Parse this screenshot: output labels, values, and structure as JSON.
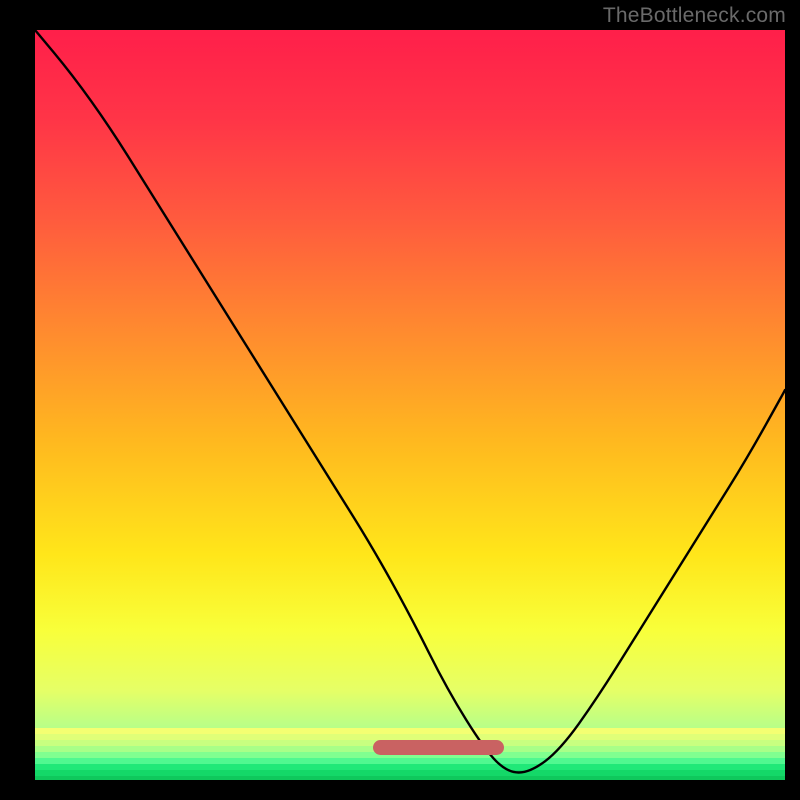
{
  "watermark": {
    "text": "TheBottleneck.com"
  },
  "gradient": {
    "stops": [
      {
        "offset": 0.0,
        "color": "#ff1f4a"
      },
      {
        "offset": 0.12,
        "color": "#ff3547"
      },
      {
        "offset": 0.25,
        "color": "#ff5a3e"
      },
      {
        "offset": 0.4,
        "color": "#ff8a2f"
      },
      {
        "offset": 0.55,
        "color": "#ffb91f"
      },
      {
        "offset": 0.7,
        "color": "#ffe61a"
      },
      {
        "offset": 0.8,
        "color": "#f8ff3a"
      },
      {
        "offset": 0.88,
        "color": "#e6ff66"
      },
      {
        "offset": 0.93,
        "color": "#b8ff88"
      },
      {
        "offset": 0.97,
        "color": "#6fff9a"
      },
      {
        "offset": 1.0,
        "color": "#14e05e"
      }
    ]
  },
  "green_bands": [
    {
      "color": "#f4ff72",
      "h": 6
    },
    {
      "color": "#e0ff78",
      "h": 6
    },
    {
      "color": "#c8ff80",
      "h": 6
    },
    {
      "color": "#a8ff88",
      "h": 6
    },
    {
      "color": "#80ff90",
      "h": 6
    },
    {
      "color": "#50f890",
      "h": 6
    },
    {
      "color": "#20e878",
      "h": 6
    },
    {
      "color": "#14d868",
      "h": 6
    },
    {
      "color": "#0fc85c",
      "h": 4
    }
  ],
  "pill": {
    "x_frac": 0.538,
    "y_frac": 0.956,
    "width_frac": 0.175,
    "height_frac": 0.02,
    "color": "#c96262"
  },
  "chart_data": {
    "type": "line",
    "title": "",
    "xlabel": "",
    "ylabel": "",
    "xlim": [
      0,
      100
    ],
    "ylim": [
      0,
      100
    ],
    "optimal_range": [
      55,
      71
    ],
    "series": [
      {
        "name": "bottleneck-curve",
        "x": [
          0,
          5,
          10,
          15,
          20,
          25,
          30,
          35,
          40,
          45,
          50,
          55,
          60,
          63,
          66,
          70,
          75,
          80,
          85,
          90,
          95,
          100
        ],
        "values": [
          100,
          94,
          87,
          79,
          71,
          63,
          55,
          47,
          39,
          31,
          22,
          12,
          4,
          1,
          1,
          4,
          11,
          19,
          27,
          35,
          43,
          52
        ]
      }
    ]
  }
}
